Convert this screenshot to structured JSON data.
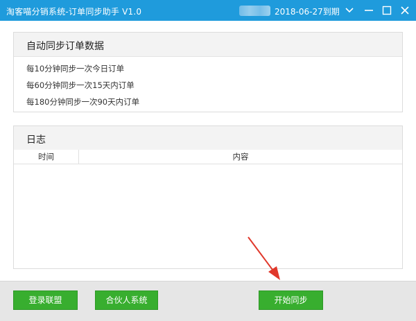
{
  "window": {
    "title": "淘客喵分销系统-订单同步助手 V1.0",
    "expire_text": "2018-06-27到期",
    "controls": [
      "dropdown-icon",
      "minimize-icon",
      "maximize-icon",
      "close-icon"
    ]
  },
  "sync_panel": {
    "title": "自动同步订单数据",
    "lines": [
      "每10分钟同步一次今日订单",
      "每60分钟同步一次15天内订单",
      "每180分钟同步一次90天内订单"
    ]
  },
  "log_panel": {
    "title": "日志",
    "columns": [
      "时间",
      "内容"
    ],
    "rows": []
  },
  "footer": {
    "buttons": [
      "登录联盟",
      "合伙人系统",
      "开始同步"
    ]
  },
  "colors": {
    "titlebar": "#1f9bdc",
    "button_green": "#38ae2f",
    "annotation_red": "#e0382b"
  }
}
